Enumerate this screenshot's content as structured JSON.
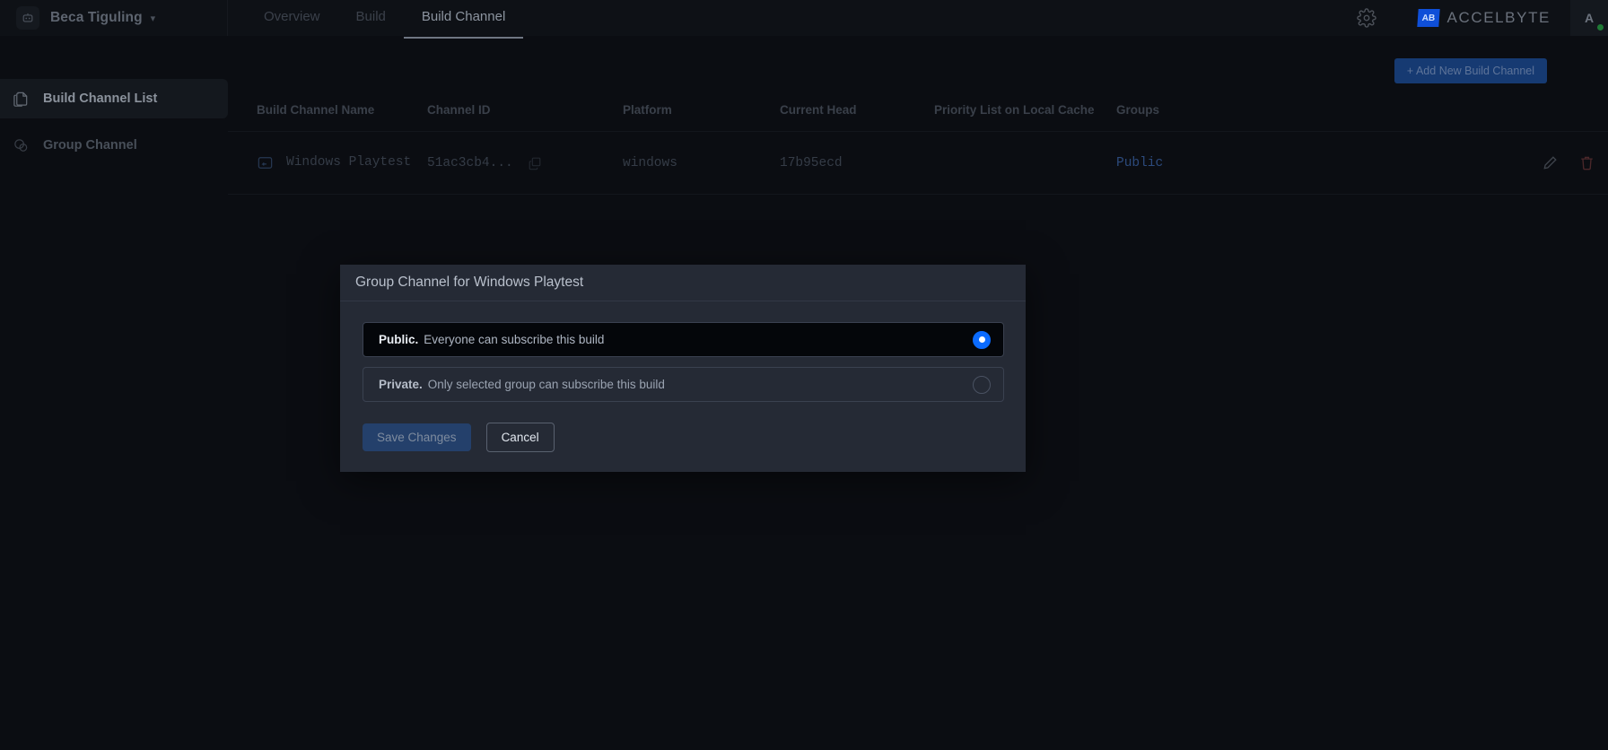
{
  "topbar": {
    "brand": {
      "name": "Beca Tiguling",
      "logo_icon": "robot-icon",
      "caret_icon": "chevron-down-icon"
    },
    "nav": [
      {
        "label": "Overview",
        "active": false
      },
      {
        "label": "Build",
        "active": false
      },
      {
        "label": "Build Channel",
        "active": true
      }
    ],
    "settings_icon": "gear-icon",
    "product_logo": {
      "badge": "AB",
      "word": "ACCELBYTE",
      "badge_color": "#0f4fd8"
    },
    "avatar": {
      "letter": "A",
      "status_color": "#1f7a35"
    }
  },
  "sidebar": {
    "items": [
      {
        "label": "Build Channel List",
        "icon": "copy-document-icon",
        "active": true
      },
      {
        "label": "Group Channel",
        "icon": "group-circles-icon",
        "active": false
      }
    ]
  },
  "main": {
    "add_button": "+ Add New Build Channel",
    "table": {
      "columns": [
        "Build Channel Name",
        "Channel ID",
        "Platform",
        "Current Head",
        "Priority List on Local Cache",
        "Groups"
      ],
      "rows": [
        {
          "name": "Windows Playtest",
          "name_icon": "channel-icon",
          "channel_id": "51ac3cb4...",
          "copy_icon": "copy-icon",
          "platform": "windows",
          "current_head": "17b95ecd",
          "priority_list": "",
          "groups": "Public",
          "groups_color": "#2c4a7c",
          "actions": [
            {
              "icon": "pencil-edit-icon"
            },
            {
              "icon": "trash-delete-icon"
            }
          ]
        }
      ]
    }
  },
  "modal": {
    "title": "Group Channel for Windows Playtest",
    "options": [
      {
        "strong": "Public.",
        "text": "Everyone can subscribe this build",
        "selected": true
      },
      {
        "strong": "Private.",
        "text": "Only selected group can subscribe this build",
        "selected": false
      }
    ],
    "save_label": "Save Changes",
    "cancel_label": "Cancel",
    "save_enabled": false,
    "accent_color": "#0b6bff"
  }
}
